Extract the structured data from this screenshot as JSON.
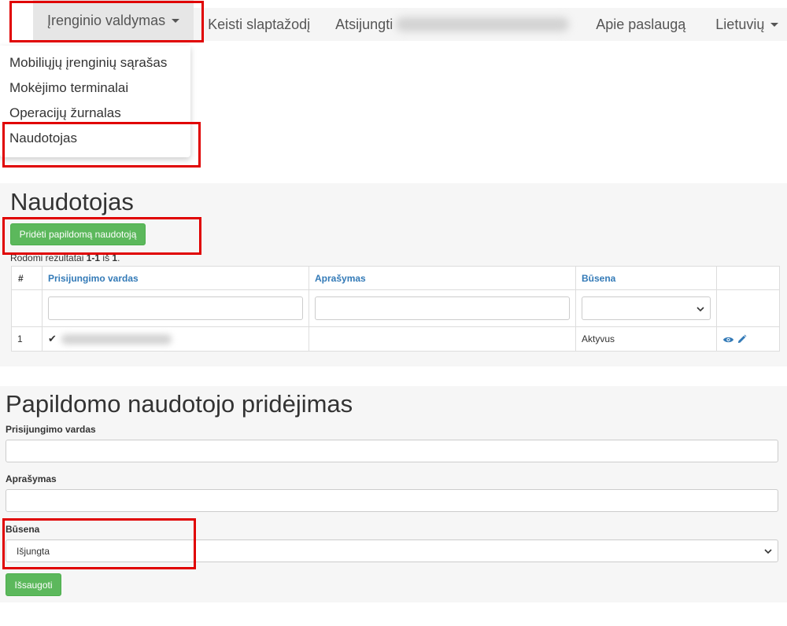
{
  "navbar": {
    "device_menu": "Įrenginio valdymas",
    "change_password": "Keisti slaptažodį",
    "logout": "Atsijungti",
    "about": "Apie paslaugą",
    "language": "Lietuvių"
  },
  "dropdown": {
    "items": [
      "Mobiliųjų įrenginių sąrašas",
      "Mokėjimo terminalai",
      "Operacijų žurnalas",
      "Naudotojas"
    ]
  },
  "users": {
    "title": "Naudotojas",
    "add_button": "Pridėti papildomą naudotoją",
    "summary_prefix": "Rodomi rezultatai ",
    "summary_range": "1-1",
    "summary_mid": " iš ",
    "summary_total": "1",
    "summary_end": ".",
    "table": {
      "headers": [
        "#",
        "Prisijungimo vardas",
        "Aprašymas",
        "Būsena",
        ""
      ],
      "rows": [
        {
          "num": "1",
          "check": "✔",
          "description": "",
          "status": "Aktyvus"
        }
      ]
    }
  },
  "add_form": {
    "title": "Papildomo naudotojo pridėjimas",
    "login_label": "Prisijungimo vardas",
    "description_label": "Aprašymas",
    "status_label": "Būsena",
    "status_value": "Išjungta",
    "save_button": "Išsaugoti"
  },
  "colors": {
    "accent_green": "#5cb85c",
    "link_blue": "#337ab7",
    "highlight_red": "#e00000"
  }
}
